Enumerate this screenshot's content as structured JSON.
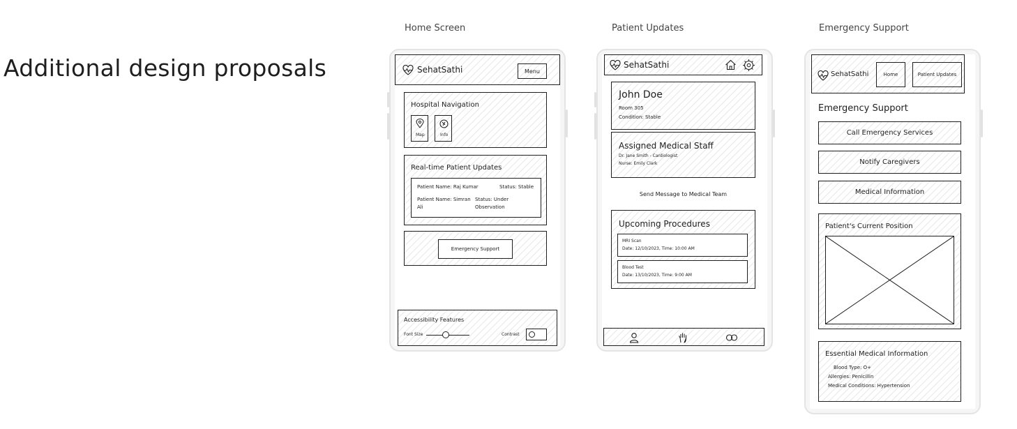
{
  "page": {
    "heading": "Additional design proposals"
  },
  "screens": {
    "home": {
      "label": "Home Screen",
      "brand": "SehatSathi",
      "menu_button": "Menu",
      "nav_title": "Hospital Navigation",
      "nav_buttons": [
        {
          "label": "Map",
          "icon": "location-pin-icon"
        },
        {
          "label": "Info",
          "icon": "info-icon"
        }
      ],
      "updates_title": "Real-time Patient Updates",
      "updates": [
        {
          "name": "Patient Name: Raj Kumar",
          "status": "Status: Stable"
        },
        {
          "name": "Patient Name: Simran Ali",
          "status": "Status: Under Observation"
        }
      ],
      "emergency_button": "Emergency Support",
      "accessibility_title": "Accessibility Features",
      "font_size_label": "Font Size",
      "font_size_level": 0.45,
      "contrast_label": "Contrast"
    },
    "patient": {
      "label": "Patient Updates",
      "brand": "SehatSathi",
      "header_icons": [
        "home-icon",
        "settings-icon"
      ],
      "patient_name": "John Doe",
      "room": "Room 305",
      "condition": "Condition: Stable",
      "staff_title": "Assigned Medical Staff",
      "staff": [
        "Dr. Jane Smith - Cardiologist",
        "Nurse: Emily Clark"
      ],
      "send_message": "Send Message to Medical Team",
      "procedures_title": "Upcoming Procedures",
      "procedures": [
        {
          "name": "MRI Scan",
          "when": "Date: 12/10/2023, Time: 10:00 AM"
        },
        {
          "name": "Blood Test",
          "when": "Date: 13/10/2023, Time: 9:00 AM"
        }
      ],
      "bottom_icons": [
        "user-icon",
        "hand-icon",
        "pills-icon"
      ]
    },
    "emergency": {
      "label": "Emergency Support",
      "brand": "SehatSathi",
      "nav_home": "Home",
      "nav_updates": "Patient Updates",
      "title": "Emergency Support",
      "actions": [
        "Call Emergency Services",
        "Notify Caregivers",
        "Medical Information"
      ],
      "position_title": "Patient's Current Position",
      "info_title": "Essential Medical Information",
      "info": [
        "Blood Type: O+",
        "Allergies: Penicillin",
        "Medical Conditions: Hypertension"
      ]
    }
  }
}
